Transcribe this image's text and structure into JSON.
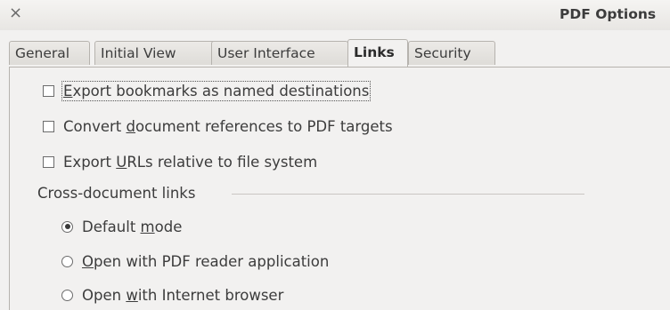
{
  "window": {
    "title": "PDF Options",
    "close_glyph": "×"
  },
  "tabs": [
    {
      "label": "General"
    },
    {
      "label": "Initial View"
    },
    {
      "label": "User Interface"
    },
    {
      "label": "Links",
      "active": true
    },
    {
      "label": "Security"
    }
  ],
  "options": {
    "export_bookmarks": {
      "before": "",
      "mnemonic": "E",
      "after": "xport bookmarks as named destinations",
      "checked": false
    },
    "convert_refs": {
      "before": "Convert ",
      "mnemonic": "d",
      "after": "ocument references to PDF targets",
      "checked": false
    },
    "export_urls": {
      "before": "Export ",
      "mnemonic": "U",
      "after": "RLs relative to file system",
      "checked": false
    }
  },
  "cross_document": {
    "label": "Cross-document links",
    "modes": [
      {
        "before": "Default ",
        "mnemonic": "m",
        "after": "ode",
        "selected": true
      },
      {
        "before": "",
        "mnemonic": "O",
        "after": "pen with PDF reader application",
        "selected": false
      },
      {
        "before": "Open ",
        "mnemonic": "w",
        "after": "ith Internet browser",
        "selected": false
      }
    ]
  },
  "icons": {
    "close": "close-icon",
    "checkbox": "checkbox-icon",
    "radio": "radio-icon"
  }
}
